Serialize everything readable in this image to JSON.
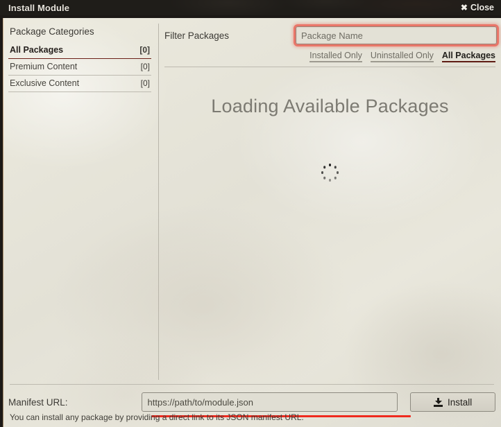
{
  "window": {
    "title": "Install Module",
    "close_label": "Close",
    "close_icon": "close-x-icon"
  },
  "sidebar": {
    "heading": "Package Categories",
    "items": [
      {
        "label": "All Packages",
        "count": "[0]",
        "active": true
      },
      {
        "label": "Premium Content",
        "count": "[0]",
        "active": false
      },
      {
        "label": "Exclusive Content",
        "count": "[0]",
        "active": false
      }
    ]
  },
  "filter": {
    "label": "Filter Packages",
    "search_placeholder": "Package Name",
    "search_value": "",
    "tabs": [
      {
        "label": "Installed Only",
        "active": false
      },
      {
        "label": "Uninstalled Only",
        "active": false
      },
      {
        "label": "All Packages",
        "active": true
      }
    ]
  },
  "main": {
    "loading_text": "Loading Available Packages",
    "spinner_icon": "loading-spinner-icon"
  },
  "footer": {
    "manifest_label": "Manifest URL:",
    "manifest_placeholder": "https://path/to/module.json",
    "manifest_value": "",
    "install_label": "Install",
    "install_icon": "download-icon",
    "hint": "You can install any package by providing a direct link to its JSON manifest URL."
  },
  "colors": {
    "accent_red": "#ef2a1e",
    "active_underline": "#5e1b13",
    "highlight_glow": "#ea5a4c",
    "parchment": "#e6e4da",
    "titlebar": "#201d1a",
    "muted_text": "#7c7a72"
  }
}
